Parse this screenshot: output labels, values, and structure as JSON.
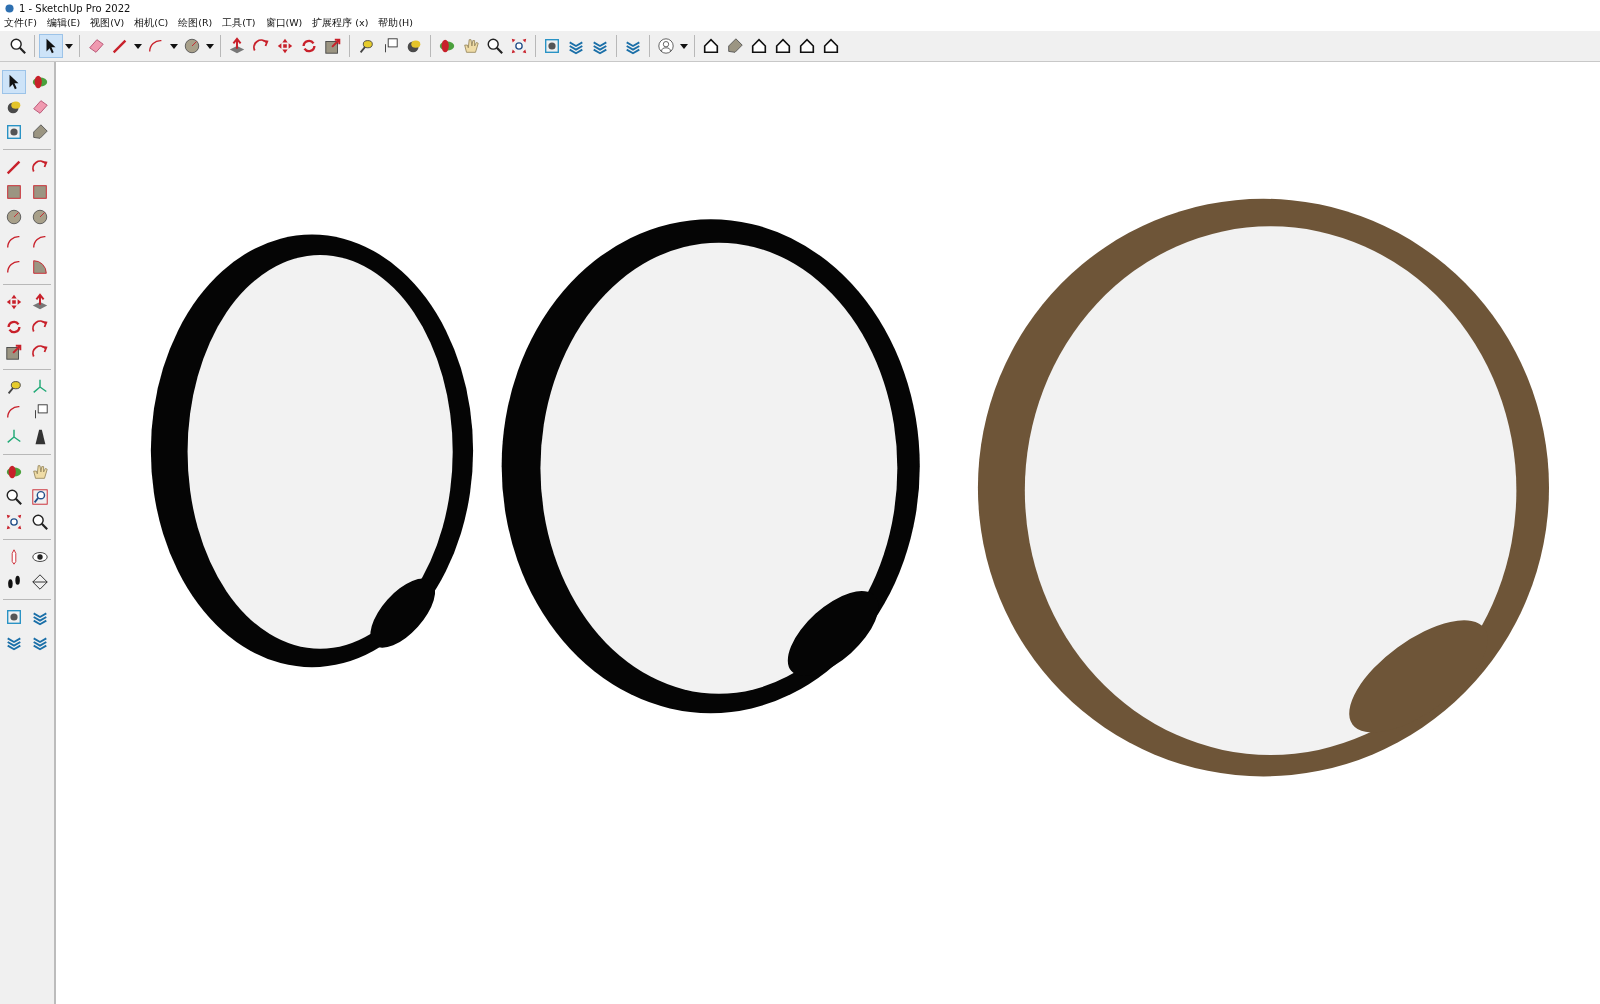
{
  "window": {
    "title": "1 - SketchUp Pro 2022"
  },
  "menu": [
    "文件(F)",
    "编辑(E)",
    "视图(V)",
    "相机(C)",
    "绘图(R)",
    "工具(T)",
    "窗口(W)",
    "扩展程序 (x)",
    "帮助(H)"
  ],
  "main_toolbar": [
    {
      "selected": false
    },
    {
      "selected": true
    },
    {
      "selected": false
    },
    {
      "selected": false
    },
    {
      "selected": false
    },
    {
      "selected": false
    },
    {
      "selected": false
    },
    {
      "selected": false
    },
    {
      "selected": false
    },
    {
      "selected": false
    },
    {
      "selected": false
    },
    {
      "selected": false
    },
    {
      "selected": false
    },
    {
      "selected": false
    },
    {
      "selected": false
    },
    {
      "selected": false
    },
    {
      "selected": false
    },
    {
      "selected": false
    },
    {
      "selected": false
    },
    {
      "selected": false
    },
    {
      "selected": false
    },
    {
      "selected": false
    },
    {
      "selected": false
    },
    {
      "selected": false
    },
    {
      "selected": false
    },
    {
      "selected": false
    },
    {
      "selected": false
    },
    {
      "selected": false
    },
    {
      "selected": false
    }
  ],
  "side_toolbar": [
    {
      "selected": true
    },
    {
      "selected": false
    },
    {
      "selected": false
    },
    {
      "selected": false
    },
    {
      "selected": false
    },
    {
      "selected": false
    },
    {
      "selected": false
    },
    {
      "selected": false
    },
    {
      "selected": false
    },
    {
      "selected": false
    },
    {
      "selected": false
    },
    {
      "selected": false
    },
    {
      "selected": false
    },
    {
      "selected": false
    },
    {
      "selected": false
    },
    {
      "selected": false
    },
    {
      "selected": false
    },
    {
      "selected": false
    },
    {
      "selected": false
    },
    {
      "selected": false
    },
    {
      "selected": false
    },
    {
      "selected": false
    },
    {
      "selected": false
    },
    {
      "selected": false
    },
    {
      "selected": false
    },
    {
      "selected": false
    },
    {
      "selected": false
    },
    {
      "selected": false
    },
    {
      "selected": false
    },
    {
      "selected": false
    },
    {
      "selected": false
    },
    {
      "selected": false
    },
    {
      "selected": false
    },
    {
      "selected": false
    },
    {
      "selected": false
    },
    {
      "selected": false
    },
    {
      "selected": false
    },
    {
      "selected": false
    },
    {
      "selected": false
    },
    {
      "selected": false
    },
    {
      "selected": false
    },
    {
      "selected": false
    }
  ],
  "mirrors": [
    {
      "kind": "black"
    },
    {
      "kind": "black"
    },
    {
      "kind": "wood"
    }
  ]
}
